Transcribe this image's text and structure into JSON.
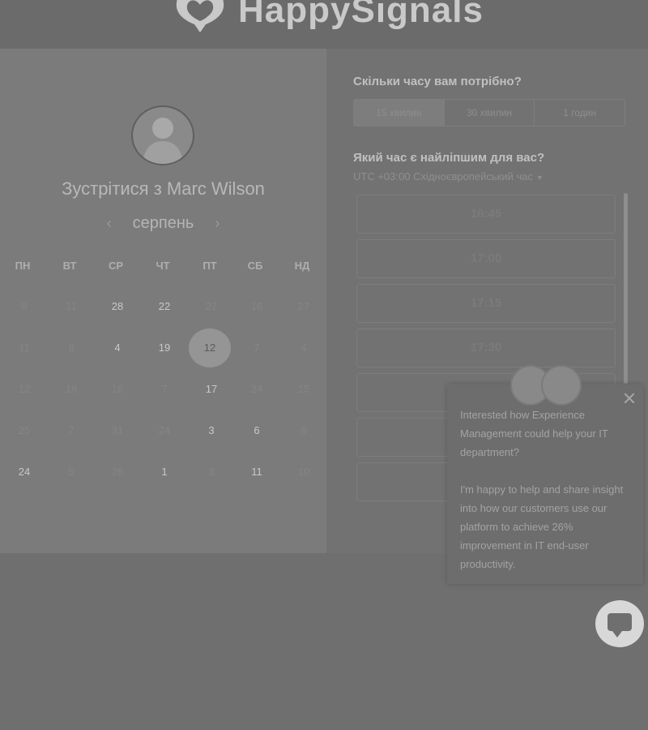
{
  "brand": {
    "name": "HappySignals"
  },
  "left": {
    "title": "Зустрітися з Marc Wilson",
    "month": "серпень",
    "prev_icon": "chevron-left-icon",
    "next_icon": "chevron-right-icon",
    "weekdays": [
      "ПН",
      "ВТ",
      "СР",
      "ЧТ",
      "ПТ",
      "СБ",
      "НД"
    ],
    "weeks": [
      [
        {
          "d": "8",
          "a": false
        },
        {
          "d": "11",
          "a": false
        },
        {
          "d": "28",
          "a": true
        },
        {
          "d": "22",
          "a": true
        },
        {
          "d": "27",
          "a": false
        },
        {
          "d": "16",
          "a": false
        },
        {
          "d": "27",
          "a": false
        }
      ],
      [
        {
          "d": "11",
          "a": false
        },
        {
          "d": "8",
          "a": false
        },
        {
          "d": "4",
          "a": true
        },
        {
          "d": "19",
          "a": true
        },
        {
          "d": "12",
          "a": true,
          "sel": true
        },
        {
          "d": "7",
          "a": false
        },
        {
          "d": "4",
          "a": false
        }
      ],
      [
        {
          "d": "12",
          "a": false
        },
        {
          "d": "18",
          "a": false
        },
        {
          "d": "16",
          "a": false
        },
        {
          "d": "7",
          "a": false
        },
        {
          "d": "17",
          "a": true
        },
        {
          "d": "24",
          "a": false
        },
        {
          "d": "15",
          "a": false
        }
      ],
      [
        {
          "d": "25",
          "a": false
        },
        {
          "d": "7",
          "a": false
        },
        {
          "d": "31",
          "a": false
        },
        {
          "d": "24",
          "a": false
        },
        {
          "d": "3",
          "a": true
        },
        {
          "d": "6",
          "a": true
        },
        {
          "d": "9",
          "a": false
        }
      ],
      [
        {
          "d": "24",
          "a": true
        },
        {
          "d": "5",
          "a": false
        },
        {
          "d": "26",
          "a": false
        },
        {
          "d": "1",
          "a": true
        },
        {
          "d": "3",
          "a": false
        },
        {
          "d": "11",
          "a": true
        },
        {
          "d": "10",
          "a": false
        }
      ]
    ]
  },
  "right": {
    "question_duration": "Скільки часу вам потрібно?",
    "durations": [
      "15 хвилин",
      "30 хвилин",
      "1 годин"
    ],
    "question_time": "Який час є найліпшим для вас?",
    "timezone": "UTC +03:00 Східноєвропейський час",
    "slots": [
      "16:45",
      "17:00",
      "17:15",
      "17:30",
      "",
      "",
      ""
    ]
  },
  "popup": {
    "line1": "Interested how Experience Management could help your IT department?",
    "line2": "I'm happy to help and share insight into how our customers use our platform to achieve 26% improvement in IT end-user productivity."
  }
}
